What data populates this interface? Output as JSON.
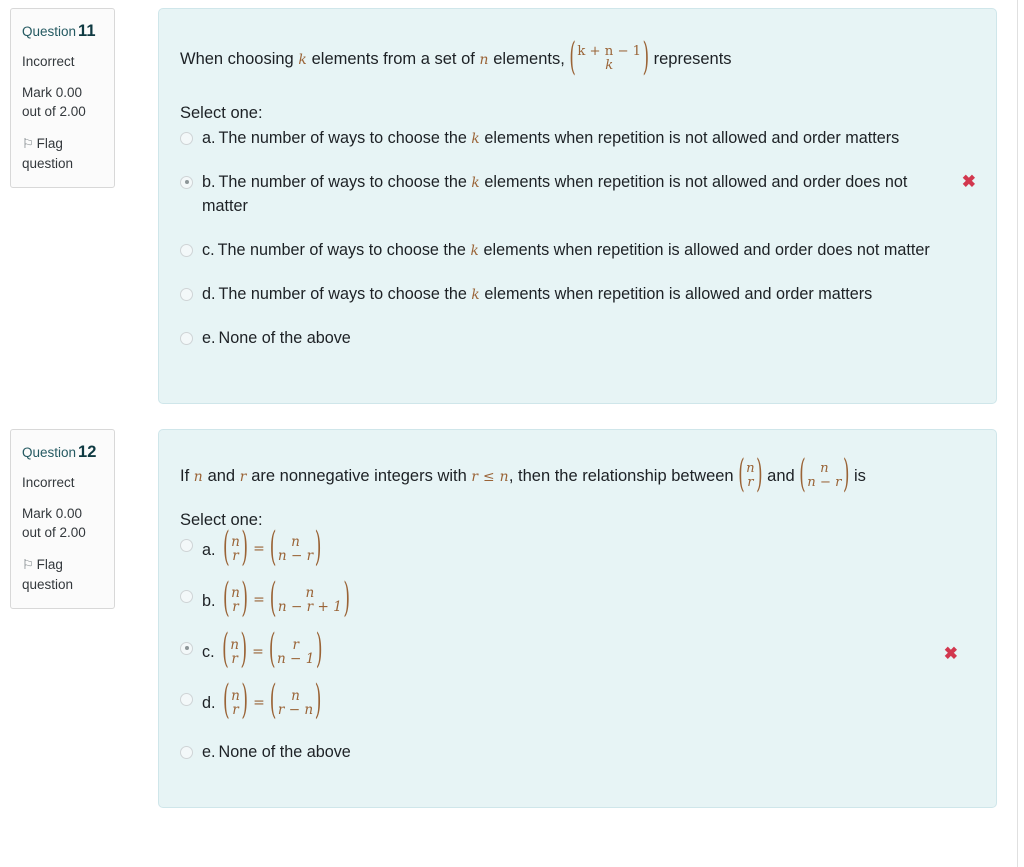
{
  "questions": [
    {
      "sidebar": {
        "label": "Question",
        "number": "11",
        "state": "Incorrect",
        "mark": "Mark 0.00 out of 2.00",
        "flag_icon": "flag-outline-icon",
        "flag_label": "Flag question"
      },
      "stem": {
        "pre": "When choosing ",
        "var1": "k",
        "mid1": " elements from a set of ",
        "var2": "n",
        "mid2": " elements, ",
        "binom": {
          "top": "k + n − 1",
          "bottom": "k"
        },
        "post": " represents"
      },
      "select_one": "Select one:",
      "options": [
        {
          "id": "a",
          "label": "a.",
          "checked": false,
          "wrong_mark": false,
          "text_pre": "The number of ways to choose the ",
          "var": "k",
          "text_post": " elements when repetition is not allowed and order matters"
        },
        {
          "id": "b",
          "label": "b.",
          "checked": true,
          "wrong_mark": true,
          "text_pre": "The number of ways to choose the ",
          "var": "k",
          "text_post": " elements when repetition is not allowed and order does not matter"
        },
        {
          "id": "c",
          "label": "c.",
          "checked": false,
          "wrong_mark": false,
          "text_pre": "The number of ways to choose the ",
          "var": "k",
          "text_post": " elements when repetition is allowed and order does not matter"
        },
        {
          "id": "d",
          "label": "d.",
          "checked": false,
          "wrong_mark": false,
          "text_pre": "The number of ways to choose the ",
          "var": "k",
          "text_post": " elements when repetition is allowed and order matters"
        },
        {
          "id": "e",
          "label": "e.",
          "checked": false,
          "wrong_mark": false,
          "text_pre": "None of the above",
          "var": "",
          "text_post": ""
        }
      ]
    },
    {
      "sidebar": {
        "label": "Question",
        "number": "12",
        "state": "Incorrect",
        "mark": "Mark 0.00 out of 2.00",
        "flag_icon": "flag-outline-icon",
        "flag_label": "Flag question"
      },
      "stem": {
        "pre": "If ",
        "var1": "n",
        "mid1": " and ",
        "var2": "r",
        "mid2": " are nonnegative integers with ",
        "cond": "r ≤ n",
        "mid3": ", then the relationship between ",
        "binom1": {
          "top": "n",
          "bottom": "r"
        },
        "mid4": " and ",
        "binom2": {
          "top": "n",
          "bottom": "n − r"
        },
        "post": " is"
      },
      "select_one": "Select one:",
      "options": [
        {
          "id": "a",
          "label": "a.",
          "checked": false,
          "wrong_mark": false,
          "equation": {
            "lhs": {
              "top": "n",
              "bottom": "r"
            },
            "op": "=",
            "rhs": {
              "top": "n",
              "bottom": "n − r"
            }
          }
        },
        {
          "id": "b",
          "label": "b.",
          "checked": false,
          "wrong_mark": false,
          "equation": {
            "lhs": {
              "top": "n",
              "bottom": "r"
            },
            "op": "=",
            "rhs": {
              "top": "n",
              "bottom": "n − r + 1"
            }
          }
        },
        {
          "id": "c",
          "label": "c.",
          "checked": true,
          "wrong_mark": true,
          "equation": {
            "lhs": {
              "top": "n",
              "bottom": "r"
            },
            "op": "=",
            "rhs": {
              "top": "r",
              "bottom": "n − 1"
            }
          }
        },
        {
          "id": "d",
          "label": "d.",
          "checked": false,
          "wrong_mark": false,
          "equation": {
            "lhs": {
              "top": "n",
              "bottom": "r"
            },
            "op": "=",
            "rhs": {
              "top": "n",
              "bottom": "r − n"
            }
          }
        },
        {
          "id": "e",
          "label": "e.",
          "checked": false,
          "wrong_mark": false,
          "plain_text": "None of the above"
        }
      ]
    }
  ],
  "icons": {
    "wrong_mark": "✖",
    "flag": "⚐"
  },
  "colors": {
    "panel_bg": "#e7f4f5",
    "panel_border": "#cfe6ea",
    "question_heading": "#255a62",
    "wrong_mark": "#d2374e",
    "math": "#9a6336"
  }
}
